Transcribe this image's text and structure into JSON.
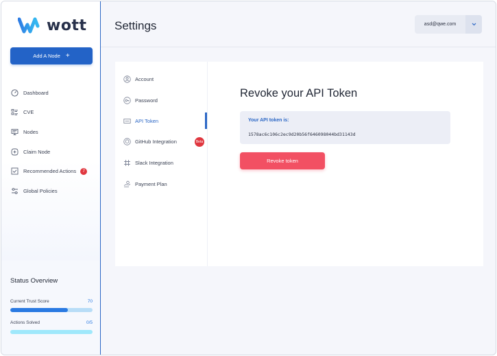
{
  "app": {
    "brand": "wott",
    "colors": {
      "primary": "#2363c7",
      "danger": "#f25063",
      "badge": "#e0373f",
      "accent": "#2a7ae2"
    }
  },
  "sidebar": {
    "add_node": {
      "label": "Add A Node",
      "icon": "plus-icon"
    },
    "items": [
      {
        "label": "Dashboard",
        "icon": "dashboard-icon"
      },
      {
        "label": "CVE",
        "icon": "list-icon"
      },
      {
        "label": "Nodes",
        "icon": "monitor-icon"
      },
      {
        "label": "Claim Node",
        "icon": "plus-square-icon"
      },
      {
        "label": "Recommended Actions",
        "icon": "checkbox-icon",
        "badge": "7"
      },
      {
        "label": "Global Policies",
        "icon": "sliders-icon"
      }
    ]
  },
  "status_overview": {
    "title": "Status Overview",
    "trust_score": {
      "label": "Current Trust Score",
      "value": "70",
      "fraction": 0.7
    },
    "actions_solved": {
      "label": "Actions Solved",
      "value": "0/5",
      "fraction": 0
    }
  },
  "header": {
    "title": "Settings",
    "user_email": "asd@qwe.com"
  },
  "settings_nav": {
    "items": [
      {
        "label": "Account",
        "icon": "user-icon"
      },
      {
        "label": "Password",
        "icon": "key-icon"
      },
      {
        "label": "API Token",
        "icon": "token-icon",
        "active": true
      },
      {
        "label": "GitHub Integration",
        "icon": "github-icon",
        "badge": "Beta"
      },
      {
        "label": "Slack Integration",
        "icon": "slack-icon"
      },
      {
        "label": "Payment Plan",
        "icon": "payment-icon"
      }
    ]
  },
  "api_token": {
    "title": "Revoke your API Token",
    "label": "Your API token is:",
    "value": "1578ac6c106c2ec9d20b56f646098044bd31143d",
    "revoke_label": "Revoke token"
  }
}
